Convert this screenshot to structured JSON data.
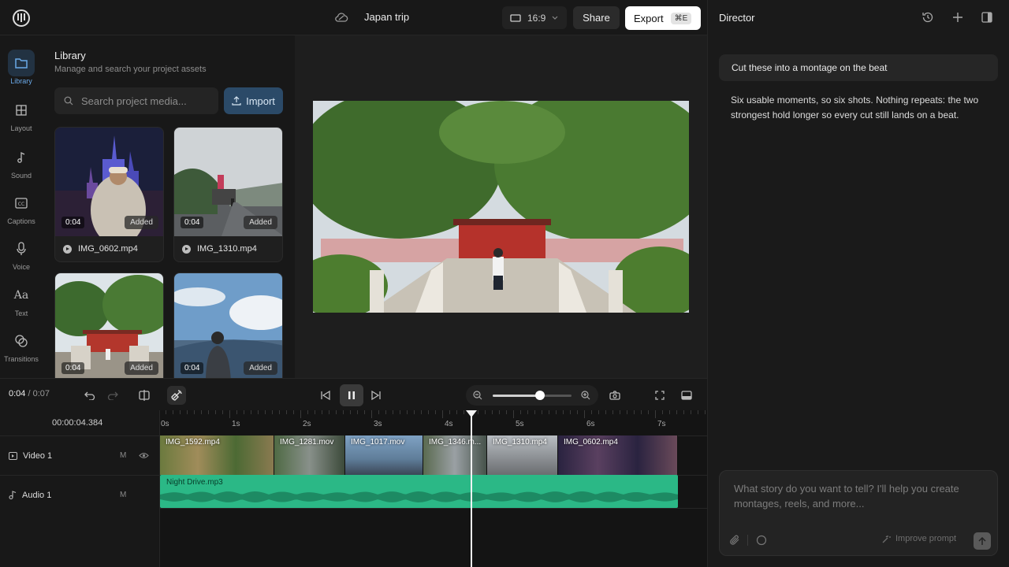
{
  "project": {
    "title": "Japan trip"
  },
  "topbar": {
    "ratio": "16:9",
    "share_label": "Share",
    "export_label": "Export",
    "export_shortcut": "⌘E"
  },
  "rail": {
    "items": [
      {
        "label": "Library",
        "icon": "folder-icon",
        "active": true
      },
      {
        "label": "Layout",
        "icon": "layout-icon"
      },
      {
        "label": "Sound",
        "icon": "music-note-icon"
      },
      {
        "label": "Captions",
        "icon": "captions-icon"
      },
      {
        "label": "Voice",
        "icon": "microphone-icon"
      },
      {
        "label": "Text",
        "icon": "text-icon"
      },
      {
        "label": "Transitions",
        "icon": "transitions-icon"
      }
    ]
  },
  "library": {
    "title": "Library",
    "subtitle": "Manage and search your project assets",
    "search_placeholder": "Search project media...",
    "import_label": "Import",
    "items": [
      {
        "name": "IMG_0602.mp4",
        "duration": "0:04",
        "badge": "Added"
      },
      {
        "name": "IMG_1310.mp4",
        "duration": "0:04",
        "badge": "Added"
      },
      {
        "name": "",
        "duration": "0:04",
        "badge": "Added"
      },
      {
        "name": "",
        "duration": "0:04",
        "badge": "Added"
      }
    ]
  },
  "transport": {
    "current": "0:04",
    "separator": "/",
    "total": "0:07",
    "zoom_level": 0.6
  },
  "timeline": {
    "timecode": "00:00:04.384",
    "ruler_labels": [
      "0s",
      "1s",
      "2s",
      "3s",
      "4s",
      "5s",
      "6s",
      "7s"
    ],
    "tracks": [
      {
        "name": "Video 1",
        "mute": "M"
      },
      {
        "name": "Audio 1",
        "mute": "M"
      }
    ],
    "clips": [
      {
        "name": "IMG_1592.mp4"
      },
      {
        "name": "IMG_1281.mov"
      },
      {
        "name": "IMG_1017.mov"
      },
      {
        "name": "IMG_1346.m..."
      },
      {
        "name": "IMG_1310.mp4"
      },
      {
        "name": "IMG_0602.mp4"
      }
    ],
    "audio_clip": "Night Drive.mp3",
    "playhead_seconds": 4.384
  },
  "director": {
    "title": "Director",
    "user_message": "Cut these into a montage on the beat",
    "assistant_message": "Six usable moments, so six shots. Nothing repeats: the two strongest hold longer so every cut still lands on a beat.",
    "composer_placeholder": "What story do you want to tell? I'll help you create montages, reels, and more...",
    "improve_label": "Improve prompt"
  },
  "colors": {
    "accent": "#2b4a68",
    "audio": "#2bb886",
    "active_rail": "#6aa9e8"
  }
}
